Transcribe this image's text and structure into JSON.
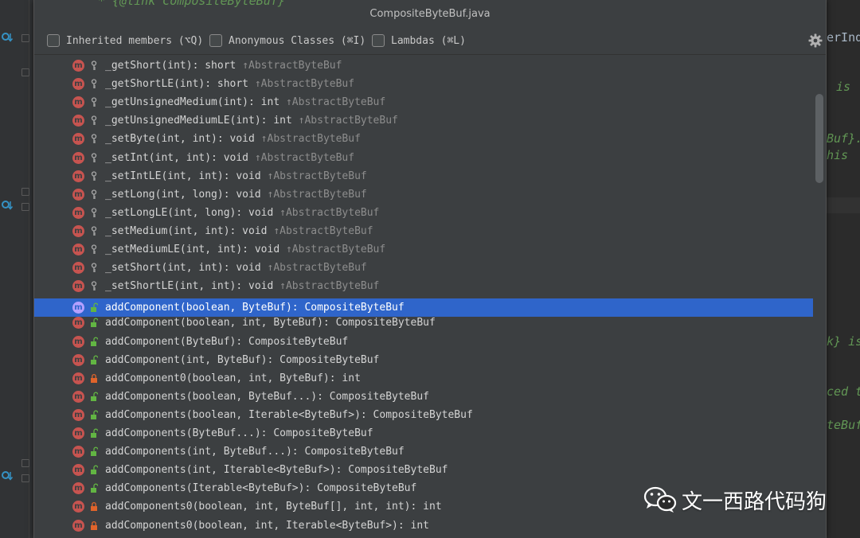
{
  "popup": {
    "title": "CompositeByteBuf.java",
    "filters": [
      {
        "label": "Inherited members (⌥Q)",
        "checked": false
      },
      {
        "label": "Anonymous Classes (⌘I)",
        "checked": false
      },
      {
        "label": "Lambdas (⌘L)",
        "checked": false
      }
    ],
    "settings_icon": "gear-icon"
  },
  "editor": {
    "top_fragment": "* {@link CompositeByteBuf}",
    "right_fragments": [
      "erInd",
      "is",
      "Buf}.",
      "his",
      "k} is",
      "ced t",
      "teBuf"
    ]
  },
  "members": [
    {
      "badge": "m",
      "access": "protected",
      "name": "_getShort(int): short",
      "inherited": "↑AbstractByteBuf"
    },
    {
      "badge": "m",
      "access": "protected",
      "name": "_getShortLE(int): short",
      "inherited": "↑AbstractByteBuf"
    },
    {
      "badge": "m",
      "access": "protected",
      "name": "_getUnsignedMedium(int): int",
      "inherited": "↑AbstractByteBuf"
    },
    {
      "badge": "m",
      "access": "protected",
      "name": "_getUnsignedMediumLE(int): int",
      "inherited": "↑AbstractByteBuf"
    },
    {
      "badge": "m",
      "access": "protected",
      "name": "_setByte(int, int): void",
      "inherited": "↑AbstractByteBuf"
    },
    {
      "badge": "m",
      "access": "protected",
      "name": "_setInt(int, int): void",
      "inherited": "↑AbstractByteBuf"
    },
    {
      "badge": "m",
      "access": "protected",
      "name": "_setIntLE(int, int): void",
      "inherited": "↑AbstractByteBuf"
    },
    {
      "badge": "m",
      "access": "protected",
      "name": "_setLong(int, long): void",
      "inherited": "↑AbstractByteBuf"
    },
    {
      "badge": "m",
      "access": "protected",
      "name": "_setLongLE(int, long): void",
      "inherited": "↑AbstractByteBuf"
    },
    {
      "badge": "m",
      "access": "protected",
      "name": "_setMedium(int, int): void",
      "inherited": "↑AbstractByteBuf"
    },
    {
      "badge": "m",
      "access": "protected",
      "name": "_setMediumLE(int, int): void",
      "inherited": "↑AbstractByteBuf"
    },
    {
      "badge": "m",
      "access": "protected",
      "name": "_setShort(int, int): void",
      "inherited": "↑AbstractByteBuf"
    },
    {
      "badge": "m",
      "access": "protected",
      "name": "_setShortLE(int, int): void",
      "inherited": "↑AbstractByteBuf"
    },
    {
      "badge": "m",
      "access": "public",
      "name": "addComponent(boolean, ByteBuf): CompositeByteBuf",
      "inherited": "",
      "selected": true
    },
    {
      "badge": "m",
      "access": "public",
      "name": "addComponent(boolean, int, ByteBuf): CompositeByteBuf",
      "inherited": ""
    },
    {
      "badge": "m",
      "access": "public",
      "name": "addComponent(ByteBuf): CompositeByteBuf",
      "inherited": ""
    },
    {
      "badge": "m",
      "access": "public",
      "name": "addComponent(int, ByteBuf): CompositeByteBuf",
      "inherited": ""
    },
    {
      "badge": "m",
      "access": "private",
      "name": "addComponent0(boolean, int, ByteBuf): int",
      "inherited": ""
    },
    {
      "badge": "m",
      "access": "public",
      "name": "addComponents(boolean, ByteBuf...): CompositeByteBuf",
      "inherited": ""
    },
    {
      "badge": "m",
      "access": "public",
      "name": "addComponents(boolean, Iterable<ByteBuf>): CompositeByteBuf",
      "inherited": ""
    },
    {
      "badge": "m",
      "access": "public",
      "name": "addComponents(ByteBuf...): CompositeByteBuf",
      "inherited": ""
    },
    {
      "badge": "m",
      "access": "public",
      "name": "addComponents(int, ByteBuf...): CompositeByteBuf",
      "inherited": ""
    },
    {
      "badge": "m",
      "access": "public",
      "name": "addComponents(int, Iterable<ByteBuf>): CompositeByteBuf",
      "inherited": ""
    },
    {
      "badge": "m",
      "access": "public",
      "name": "addComponents(Iterable<ByteBuf>): CompositeByteBuf",
      "inherited": ""
    },
    {
      "badge": "m",
      "access": "private",
      "name": "addComponents0(boolean, int, ByteBuf[], int, int): int",
      "inherited": ""
    },
    {
      "badge": "m",
      "access": "private",
      "name": "addComponents0(boolean, int, Iterable<ByteBuf>): int",
      "inherited": ""
    }
  ],
  "colors": {
    "selection": "#2f65ca",
    "method_badge": "#c75450",
    "public_icon": "#62b543",
    "private_icon": "#e0642b",
    "protected_icon": "#a9a9a9"
  },
  "watermark": {
    "text": "文一西路代码狗",
    "icon": "wechat-icon"
  }
}
